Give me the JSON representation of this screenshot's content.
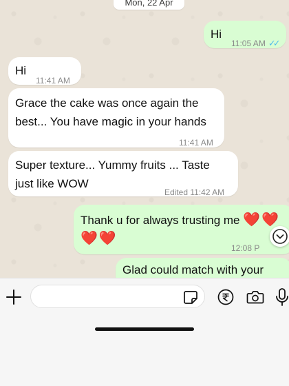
{
  "date_label": "Mon, 22 Apr",
  "messages": [
    {
      "direction": "outgoing",
      "lines": [
        "Hi"
      ],
      "time": "11:05 AM",
      "read_ticks": "✓✓"
    },
    {
      "direction": "incoming",
      "lines": [
        "Hi"
      ],
      "time": "11:41 AM"
    },
    {
      "direction": "incoming",
      "lines": [
        "Grace the cake was once again the",
        "best... You have magic in your hands"
      ],
      "time": "11:41 AM"
    },
    {
      "direction": "incoming",
      "lines": [
        "Super texture... Yummy fruits ... Taste",
        "just like WOW"
      ],
      "time": "Edited 11:42 AM"
    },
    {
      "direction": "outgoing",
      "lines": [
        "Thank u for always trusting me"
      ],
      "hearts_line1": "❤️❤️",
      "hearts_line2": "❤️❤️",
      "time": "12:08 P"
    },
    {
      "direction": "outgoing",
      "lines": [
        "Glad could match with your"
      ]
    }
  ],
  "input": {
    "placeholder": ""
  },
  "icons": {
    "attach": "plus-icon",
    "sticker": "sticker-icon",
    "payment": "rupee-icon",
    "camera": "camera-icon",
    "mic": "microphone-icon",
    "scroll": "chevron-down-icon"
  },
  "colors": {
    "chat_background": "#eae3d8",
    "incoming_bubble": "#ffffff",
    "outgoing_bubble": "#d9fdd3",
    "read_ticks": "#53bdeb",
    "timestamp": "#8a8a8a"
  }
}
